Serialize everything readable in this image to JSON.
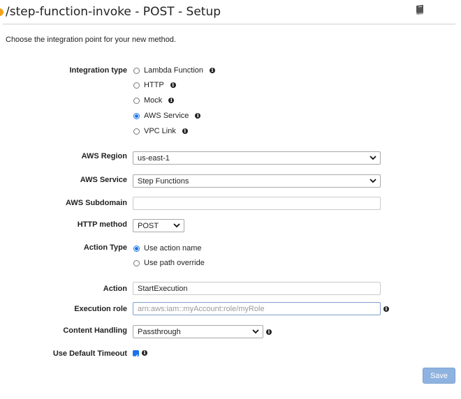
{
  "header": {
    "title": "/step-function-invoke - POST - Setup",
    "icon": "book-icon"
  },
  "intro_text": "Choose the integration point for your new method.",
  "integration_type": {
    "label": "Integration type",
    "options": [
      {
        "label": "Lambda Function",
        "selected": false
      },
      {
        "label": "HTTP",
        "selected": false
      },
      {
        "label": "Mock",
        "selected": false
      },
      {
        "label": "AWS Service",
        "selected": true
      },
      {
        "label": "VPC Link",
        "selected": false
      }
    ]
  },
  "aws_region": {
    "label": "AWS Region",
    "value": "us-east-1"
  },
  "aws_service": {
    "label": "AWS Service",
    "value": "Step Functions"
  },
  "aws_subdomain": {
    "label": "AWS Subdomain",
    "value": ""
  },
  "http_method": {
    "label": "HTTP method",
    "value": "POST"
  },
  "action_type": {
    "label": "Action Type",
    "options": [
      {
        "label": "Use action name",
        "selected": true
      },
      {
        "label": "Use path override",
        "selected": false
      }
    ]
  },
  "action": {
    "label": "Action",
    "value": "StartExecution"
  },
  "execution_role": {
    "label": "Execution role",
    "placeholder": "arn:aws:iam::myAccount:role/myRole"
  },
  "content_handling": {
    "label": "Content Handling",
    "value": "Passthrough"
  },
  "default_timeout": {
    "label": "Use Default Timeout",
    "checked": true
  },
  "save_label": "Save",
  "colors": {
    "accent": "#1a73e8",
    "save_button": "#8fb3e0",
    "title_icon": "#f1a31b"
  }
}
